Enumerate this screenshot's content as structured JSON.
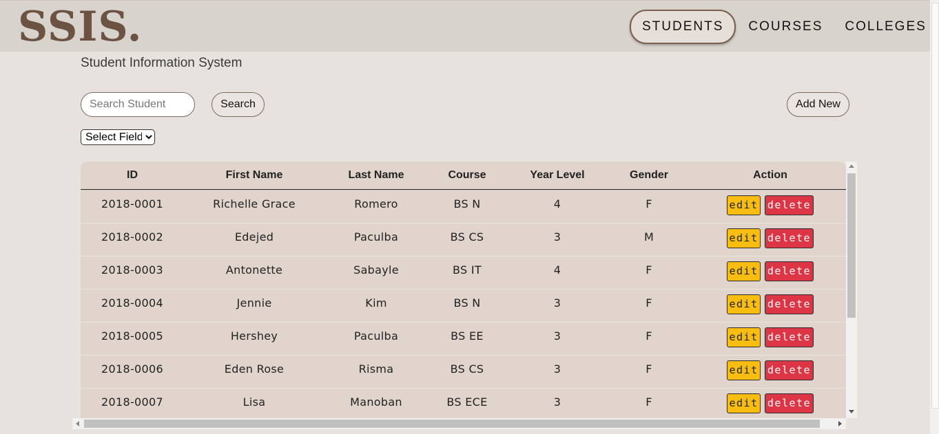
{
  "header": {
    "logo": "SSIS.",
    "nav": [
      "STUDENTS",
      "COURSES",
      "COLLEGES"
    ],
    "active_nav": "STUDENTS"
  },
  "subtitle": "Student Information System",
  "search": {
    "placeholder": "Search Student",
    "value": "",
    "button_label": "Search"
  },
  "add_new_label": "Add New",
  "select_field": {
    "selected": "Select Field"
  },
  "table": {
    "columns": [
      "ID",
      "First Name",
      "Last Name",
      "Course",
      "Year Level",
      "Gender",
      "Action"
    ],
    "rows": [
      [
        "2018-0001",
        "Richelle Grace",
        "Romero",
        "BS N",
        "4",
        "F"
      ],
      [
        "2018-0002",
        "Edejed",
        "Paculba",
        "BS CS",
        "3",
        "M"
      ],
      [
        "2018-0003",
        "Antonette",
        "Sabayle",
        "BS IT",
        "4",
        "F"
      ],
      [
        "2018-0004",
        "Jennie",
        "Kim",
        "BS N",
        "3",
        "F"
      ],
      [
        "2018-0005",
        "Hershey",
        "Paculba",
        "BS EE",
        "3",
        "F"
      ],
      [
        "2018-0006",
        "Eden Rose",
        "Risma",
        "BS CS",
        "3",
        "F"
      ],
      [
        "2018-0007",
        "Lisa",
        "Manoban",
        "BS ECE",
        "3",
        "F"
      ]
    ],
    "edit_label": "edit",
    "delete_label": "delete"
  },
  "colors": {
    "page_bg": "#e8e2de",
    "header_bg": "#d9d3ce",
    "logo": "#6b5241",
    "table_bg": "#e0d4cc",
    "edit_button": "#f7be11",
    "delete_button": "#dc3545"
  }
}
